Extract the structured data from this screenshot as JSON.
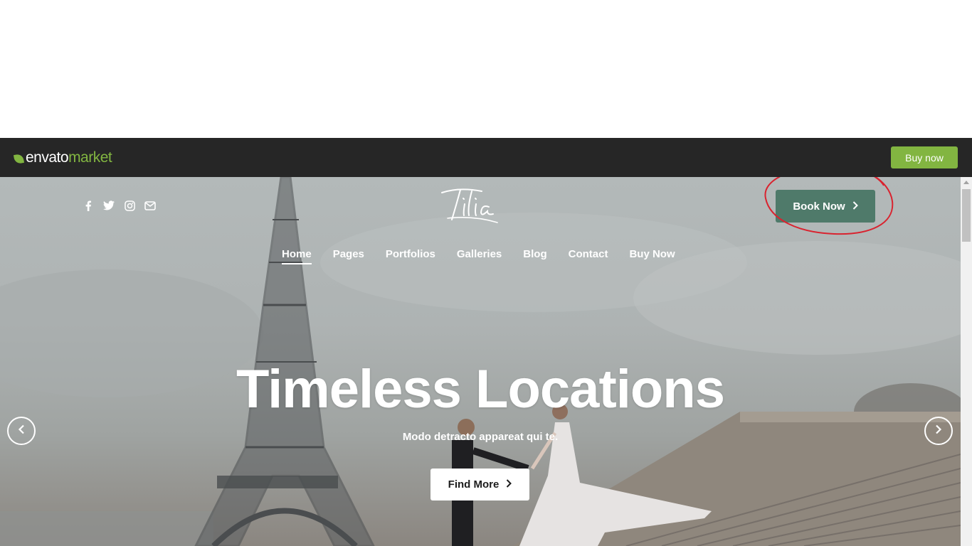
{
  "envato": {
    "logo_envato": "envato",
    "logo_market": "market",
    "buy_now": "Buy now",
    "brand_color": "#82b541"
  },
  "header": {
    "social_icons": [
      "facebook-icon",
      "twitter-icon",
      "instagram-icon",
      "mail-icon"
    ],
    "logo_text": "Tilia",
    "book_now": "Book Now",
    "book_now_color": "#4f7a6a"
  },
  "nav": {
    "items": [
      "Home",
      "Pages",
      "Portfolios",
      "Galleries",
      "Blog",
      "Contact",
      "Buy Now"
    ],
    "active": "Home"
  },
  "hero": {
    "title": "Timeless Locations",
    "subtitle": "Modo detracto appareat qui te.",
    "cta": "Find More"
  }
}
